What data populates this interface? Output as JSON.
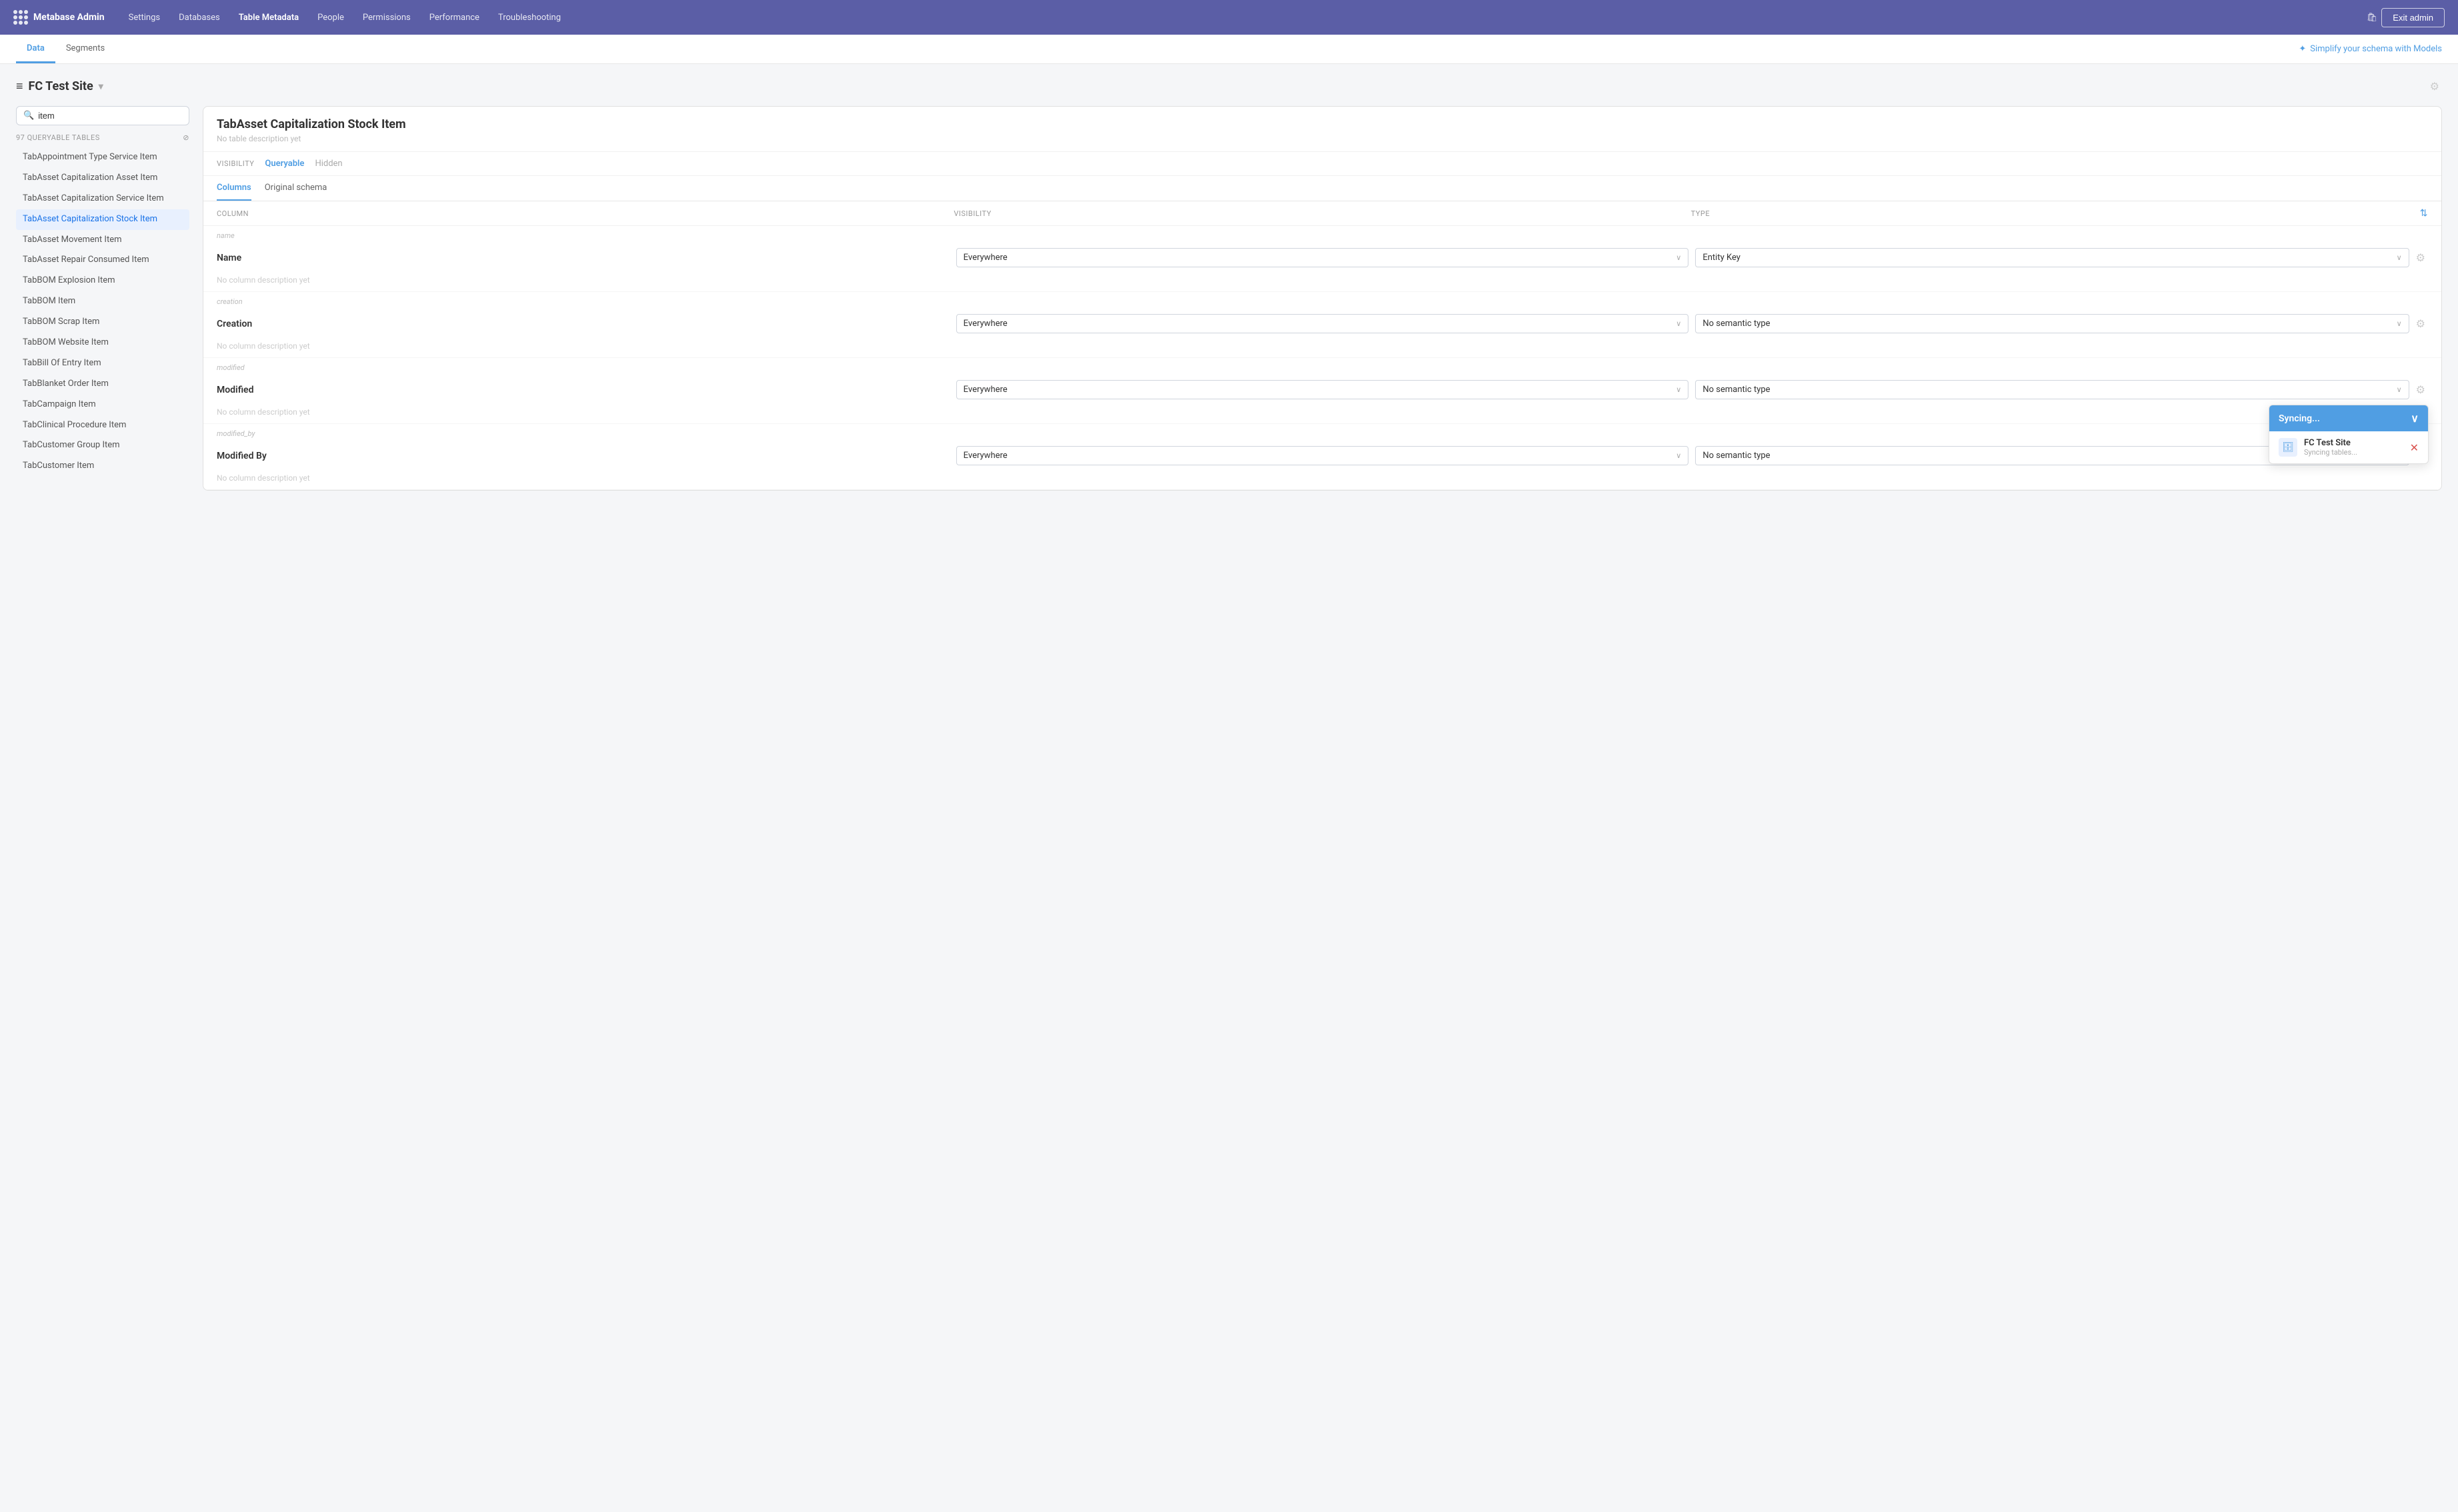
{
  "topNav": {
    "appName": "Metabase Admin",
    "items": [
      {
        "label": "Settings",
        "active": false
      },
      {
        "label": "Databases",
        "active": false
      },
      {
        "label": "Table Metadata",
        "active": true
      },
      {
        "label": "People",
        "active": false
      },
      {
        "label": "Permissions",
        "active": false
      },
      {
        "label": "Performance",
        "active": false
      },
      {
        "label": "Troubleshooting",
        "active": false
      }
    ],
    "exitLabel": "Exit admin"
  },
  "subNav": {
    "tabs": [
      {
        "label": "Data",
        "active": true
      },
      {
        "label": "Segments",
        "active": false
      }
    ],
    "simplifyLink": "Simplify your schema with Models"
  },
  "dbHeader": {
    "title": "FC Test Site",
    "arrow": "▾"
  },
  "sidebar": {
    "searchPlaceholder": "item",
    "searchValue": "item",
    "metaLabel": "97 QUERYABLE TABLES",
    "items": [
      {
        "label": "TabAppointment Type Service Item",
        "active": false
      },
      {
        "label": "TabAsset Capitalization Asset Item",
        "active": false
      },
      {
        "label": "TabAsset Capitalization Service Item",
        "active": false
      },
      {
        "label": "TabAsset Capitalization Stock Item",
        "active": true
      },
      {
        "label": "TabAsset Movement Item",
        "active": false
      },
      {
        "label": "TabAsset Repair Consumed Item",
        "active": false
      },
      {
        "label": "TabBOM Explosion Item",
        "active": false
      },
      {
        "label": "TabBOM Item",
        "active": false
      },
      {
        "label": "TabBOM Scrap Item",
        "active": false
      },
      {
        "label": "TabBOM Website Item",
        "active": false
      },
      {
        "label": "TabBill Of Entry Item",
        "active": false
      },
      {
        "label": "TabBlanket Order Item",
        "active": false
      },
      {
        "label": "TabCampaign Item",
        "active": false
      },
      {
        "label": "TabClinical Procedure Item",
        "active": false
      },
      {
        "label": "TabCustomer Group Item",
        "active": false
      },
      {
        "label": "TabCustomer Item",
        "active": false
      }
    ]
  },
  "tablePanel": {
    "title": "TabAsset Capitalization Stock Item",
    "description": "No table description yet",
    "visibilityLabel": "VISIBILITY",
    "visibilityOptions": [
      {
        "label": "Queryable",
        "active": true
      },
      {
        "label": "Hidden",
        "active": false
      }
    ],
    "tabs": [
      {
        "label": "Columns",
        "active": true
      },
      {
        "label": "Original schema",
        "active": false
      }
    ],
    "columnsHeader": {
      "column": "COLUMN",
      "visibility": "VISIBILITY",
      "type": "TYPE"
    },
    "columns": [
      {
        "fieldLabel": "name",
        "name": "Name",
        "visibility": "Everywhere",
        "type": "Entity Key",
        "description": "No column description yet"
      },
      {
        "fieldLabel": "creation",
        "name": "Creation",
        "visibility": "Everywhere",
        "type": "No semantic type",
        "description": "No column description yet"
      },
      {
        "fieldLabel": "modified",
        "name": "Modified",
        "visibility": "Everywhere",
        "type": "No semantic type",
        "description": "No column description yet"
      },
      {
        "fieldLabel": "modified_by",
        "name": "Modified By",
        "visibility": "Everywhere",
        "type": "No semantic type",
        "description": "No column description yet"
      }
    ]
  },
  "syncPopup": {
    "headerLabel": "Syncing...",
    "dbName": "FC Test Site",
    "statusLabel": "Syncing tables..."
  },
  "icons": {
    "logo": "⠿",
    "search": "🔍",
    "gear": "⚙",
    "sort": "⇅",
    "chevronDown": "∨",
    "chevronUp": "∧",
    "dbIcon": "🗄",
    "cancel": "✕",
    "shopBag": "🛍",
    "eye": "👁",
    "eyeOff": "⊘",
    "sparkle": "✦"
  }
}
